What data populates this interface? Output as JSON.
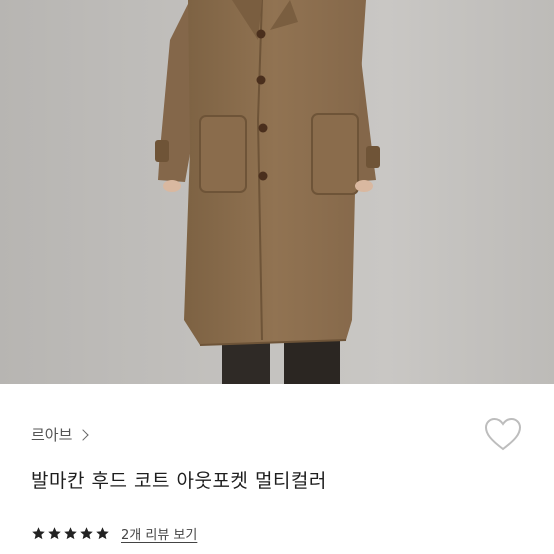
{
  "product": {
    "image_alt": "camel wool single coat product photo",
    "brand": "르아브",
    "title": "발마칸 후드 코트 아웃포켓 멀티컬러",
    "rating": 5,
    "review_link": "2개 리뷰 보기"
  },
  "colors": {
    "coat": "#8f7150",
    "background": "#c4c2bf",
    "star": "#222222",
    "text": "#1e1e1e"
  },
  "icons": {
    "brand_chevron": "chevron-right-icon",
    "wish": "heart-outline-icon",
    "star": "star-filled-icon"
  }
}
